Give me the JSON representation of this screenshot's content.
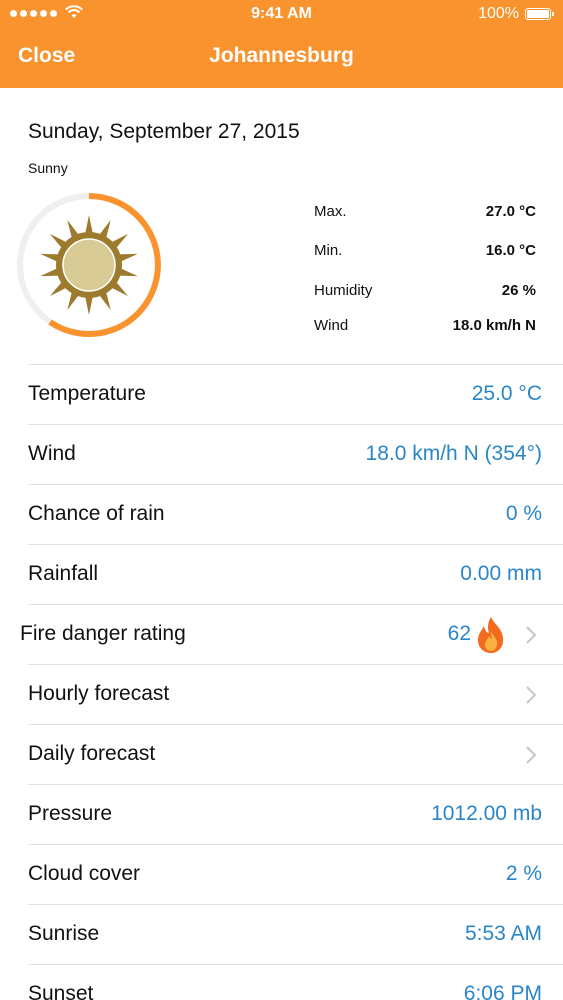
{
  "status_bar": {
    "time": "9:41 AM",
    "battery": "100%"
  },
  "nav": {
    "close_label": "Close",
    "title": "Johannesburg"
  },
  "summary": {
    "date": "Sunday, September 27, 2015",
    "condition": "Sunny",
    "icon": "sun-icon",
    "stats": [
      {
        "label": "Max.",
        "value": "27.0 °C"
      },
      {
        "label": "Min.",
        "value": "16.0 °C"
      },
      {
        "label": "Humidity",
        "value": "26 %"
      },
      {
        "label": "Wind",
        "value": "18.0 km/h N"
      }
    ]
  },
  "rows": [
    {
      "label": "Temperature",
      "value": "25.0 °C"
    },
    {
      "label": "Wind",
      "value": "18.0 km/h N (354°)"
    },
    {
      "label": "Chance of rain",
      "value": "0 %"
    },
    {
      "label": "Rainfall",
      "value": "0.00 mm"
    },
    {
      "label": "Fire danger rating",
      "value": "62",
      "icon": "flame-icon"
    },
    {
      "label": "Hourly forecast",
      "value": ""
    },
    {
      "label": "Daily forecast",
      "value": ""
    },
    {
      "label": "Pressure",
      "value": "1012.00 mb"
    },
    {
      "label": "Cloud cover",
      "value": "2 %"
    },
    {
      "label": "Sunrise",
      "value": "5:53 AM"
    },
    {
      "label": "Sunset",
      "value": "6:06 PM"
    }
  ],
  "colors": {
    "accent": "#F8932E",
    "value_blue": "#2A86C8",
    "sun_outer": "#9C7A2E",
    "sun_inner": "#D8CB96"
  }
}
